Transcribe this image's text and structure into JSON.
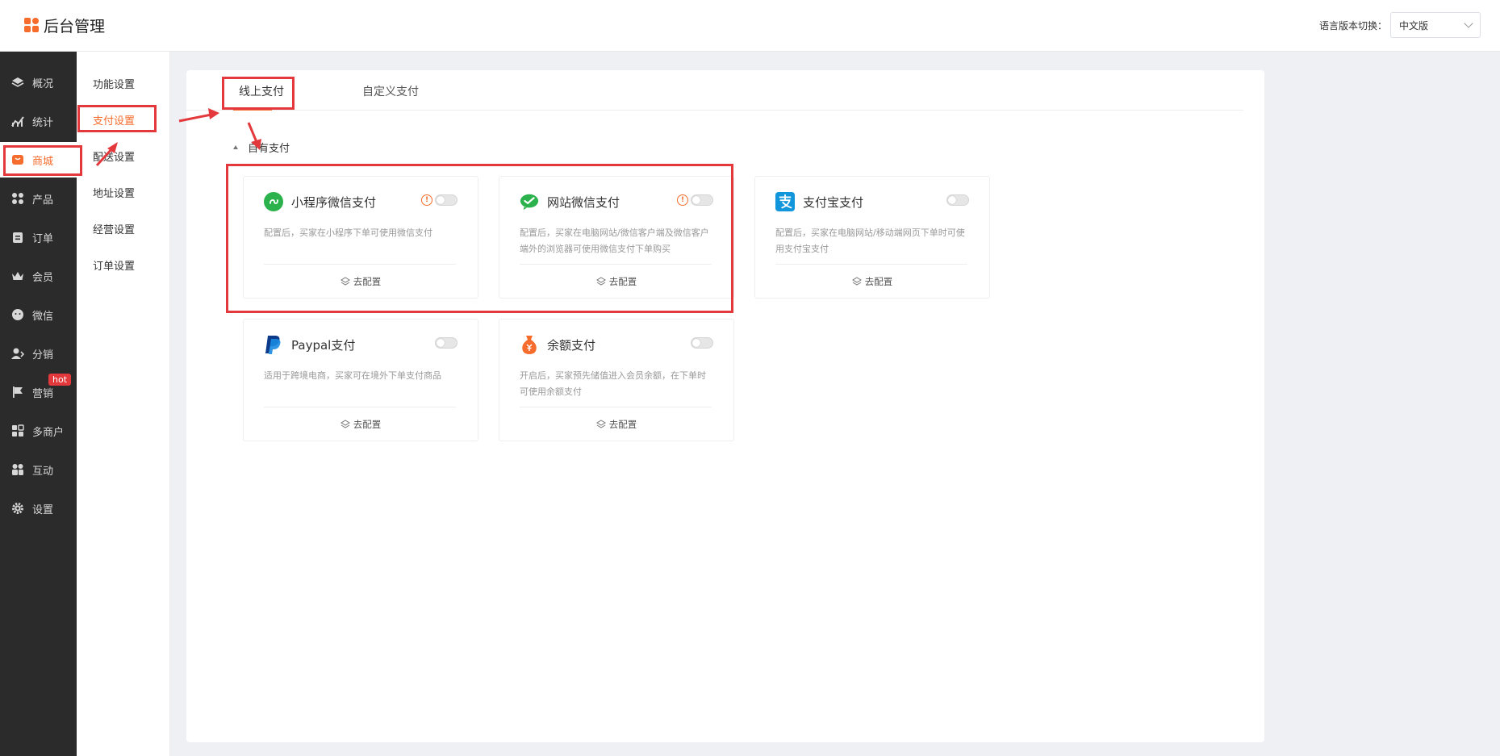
{
  "app": {
    "title": "后台管理"
  },
  "header": {
    "lang_label": "语言版本切换：",
    "lang_value": "中文版"
  },
  "nav": {
    "items": [
      {
        "label": "概况",
        "icon": "layers-icon"
      },
      {
        "label": "统计",
        "icon": "chart-icon"
      },
      {
        "label": "商城",
        "icon": "shop-icon"
      },
      {
        "label": "产品",
        "icon": "grid-icon"
      },
      {
        "label": "订单",
        "icon": "clipboard-icon"
      },
      {
        "label": "会员",
        "icon": "crown-icon"
      },
      {
        "label": "微信",
        "icon": "wechat-icon"
      },
      {
        "label": "分销",
        "icon": "user-share-icon"
      },
      {
        "label": "营销",
        "icon": "flag-icon"
      },
      {
        "label": "多商户",
        "icon": "merchant-icon"
      },
      {
        "label": "互动",
        "icon": "interact-icon"
      },
      {
        "label": "设置",
        "icon": "gear-icon"
      }
    ],
    "badge": "hot",
    "active_index": 2,
    "accent": "#f56c2d"
  },
  "subnav": {
    "items": [
      "功能设置",
      "支付设置",
      "配送设置",
      "地址设置",
      "经营设置",
      "订单设置"
    ],
    "active_index": 1
  },
  "tabs": [
    "线上支付",
    "自定义支付"
  ],
  "section_title": "自有支付",
  "payments": [
    {
      "name": "小程序微信支付",
      "desc": "配置后，买家在小程序下单可使用微信支付",
      "config": "去配置",
      "warn": "!",
      "icon": "miniprogram-icon",
      "enabled": false
    },
    {
      "name": "网站微信支付",
      "desc": "配置后，买家在电脑网站/微信客户端及微信客户端外的浏览器可使用微信支付下单购买",
      "config": "去配置",
      "warn": "!",
      "icon": "wechat-pay-icon",
      "enabled": false
    },
    {
      "name": "支付宝支付",
      "desc": "配置后，买家在电脑网站/移动端网页下单时可使用支付宝支付",
      "config": "去配置",
      "warn": "",
      "icon": "alipay-icon",
      "enabled": false
    },
    {
      "name": "Paypal支付",
      "desc": "适用于跨境电商，买家可在境外下单支付商品",
      "config": "去配置",
      "warn": "",
      "icon": "paypal-icon",
      "enabled": false
    },
    {
      "name": "余额支付",
      "desc": "开启后，买家预先储值进入会员余额，在下单时可使用余额支付",
      "config": "去配置",
      "warn": "",
      "icon": "moneybag-icon",
      "enabled": false
    }
  ],
  "colors": {
    "accent": "#f56c2d",
    "annotation": "#e4393c",
    "nav_bg": "#2b2b2b"
  }
}
